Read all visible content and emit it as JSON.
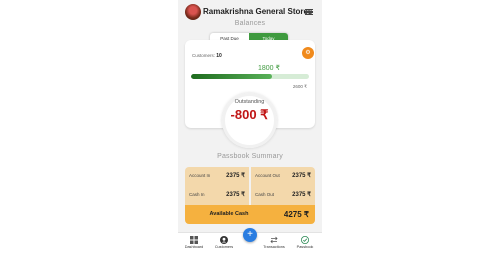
{
  "header": {
    "brand": "Ramakrishna General Stores",
    "menu_icon": "hamburger-icon"
  },
  "balances": {
    "title": "Balances",
    "tabs": [
      "Past Due",
      "Today"
    ],
    "active_tab": "Today",
    "customers_label": "Customers:",
    "customers_count": "10",
    "collected": "1800 ₹",
    "total": "2600 ₹",
    "progress_fraction": 0.69,
    "outstanding_label": "Outstanding",
    "outstanding_value": "-800 ₹"
  },
  "passbook": {
    "title": "Passbook Summary",
    "account_in_label": "Account In",
    "account_in_value": "2375 ₹",
    "account_out_label": "Account Out",
    "account_out_value": "2375 ₹",
    "cash_in_label": "Cash In",
    "cash_in_value": "2375 ₹",
    "cash_out_label": "Cash Out",
    "cash_out_value": "2375 ₹",
    "available_label": "Available Cash",
    "available_value": "4275 ₹"
  },
  "nav": {
    "items": [
      "Dashboard",
      "Customers",
      "Transactions",
      "Passbook"
    ],
    "fab_symbol": "+"
  },
  "colors": {
    "green": "#3f9a3f",
    "orange": "#f08a1c",
    "red": "#c01515",
    "amber": "#f5b13f",
    "blue": "#2a7de1"
  }
}
